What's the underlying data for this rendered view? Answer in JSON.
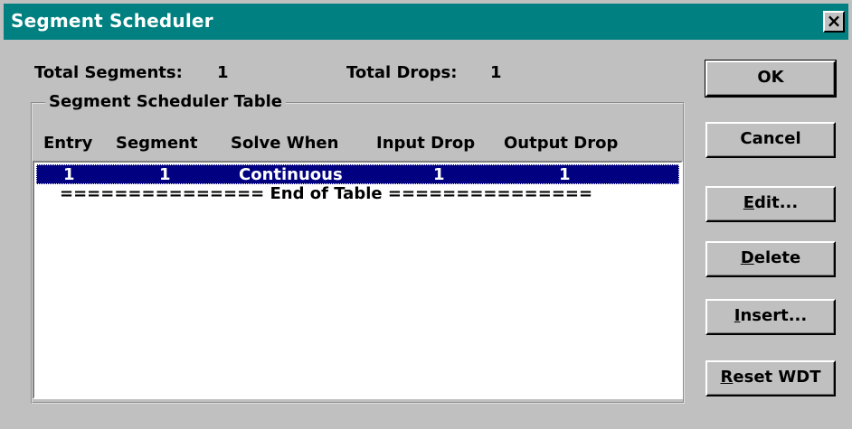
{
  "window": {
    "title": "Segment Scheduler",
    "close_glyph": "×",
    "close_icon": "close-icon"
  },
  "summary": {
    "total_segments_label": "Total Segments:",
    "total_segments_value": "1",
    "total_drops_label": "Total Drops:",
    "total_drops_value": "1"
  },
  "table": {
    "group_label": "Segment Scheduler Table",
    "columns": [
      "Entry",
      "Segment",
      "Solve When",
      "Input Drop",
      "Output Drop"
    ],
    "rows": [
      {
        "entry": "1",
        "segment": "1",
        "solve_when": "Continuous",
        "input_drop": "1",
        "output_drop": "1",
        "selected": true
      }
    ],
    "end_text": "=============== End of Table ==============="
  },
  "buttons": {
    "ok": "OK",
    "cancel": "Cancel",
    "edit": {
      "accel": "E",
      "rest": "dit..."
    },
    "delete": {
      "accel": "D",
      "rest": "elete"
    },
    "insert": {
      "accel": "I",
      "rest": "nsert..."
    },
    "reset": {
      "accel": "R",
      "rest": "eset WDT"
    }
  },
  "colors": {
    "titlebar": "#008080",
    "selection": "#000080",
    "face": "#c0c0c0"
  }
}
